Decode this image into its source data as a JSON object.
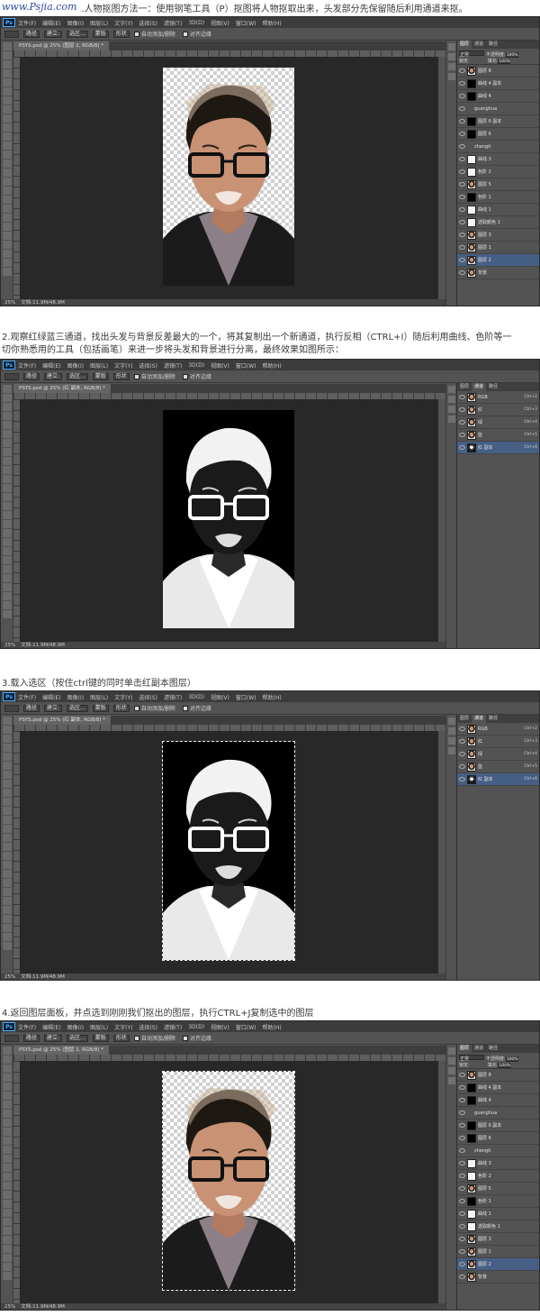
{
  "watermark": "www.Psjia.com",
  "steps": [
    {
      "caption": "1.人物抠图方法一：使用钢笔工具（P）抠图将人物抠取出来，头发部分先保留随后利用通道来抠。"
    },
    {
      "caption": "2.观察红绿蓝三通道，找出头发与背景反差最大的一个，将其复制出一个新通道，执行反相（CTRL+I）随后利用曲线、色阶等一",
      "caption2": "切你熟悉用的工具（包括画笔）来进一步将头发和背景进行分离，最终效果如图所示："
    },
    {
      "caption": "3.载入选区（按住ctrl键的同时单击红副本图层）"
    },
    {
      "caption": "4.返回图层面板，并点选到刚刚我们抠出的图层，执行CTRL+J复制选中的图层"
    }
  ],
  "ps": {
    "logo": "Ps",
    "menus": [
      "文件(F)",
      "编辑(E)",
      "图像(I)",
      "图层(L)",
      "文字(Y)",
      "选择(S)",
      "滤镜(T)",
      "3D(D)",
      "视图(V)",
      "窗口(W)",
      "帮助(H)"
    ],
    "options": [
      "路径",
      "建立:",
      "选区...",
      "蒙版",
      "形状"
    ],
    "auto_add": "自动添加/删除",
    "align_edges": "对齐边缘",
    "doc_tab": "PSYS.psd @ 25% (图层 2, RGB/8) *",
    "doc_tab_channel": "PSYS.psd @ 25% (红 副本, RGB/8) *",
    "zoom": "25%",
    "doc_size": "文档:11.9M/48.9M"
  },
  "layers_panel": {
    "tabs": [
      "图层",
      "通道",
      "路径"
    ],
    "mode": "正常",
    "opacity_label": "不透明度:",
    "opacity": "100%",
    "lock_label": "锁定:",
    "fill_label": "填充:",
    "fill": "100%",
    "layers": [
      {
        "name": "图层 8",
        "thumb": "face"
      },
      {
        "name": "曲线 4 副本",
        "thumb": "mask"
      },
      {
        "name": "曲线 4",
        "thumb": "mask"
      },
      {
        "name": "guanghua",
        "thumb": "group"
      },
      {
        "name": "图层 6 副本",
        "thumb": "mask"
      },
      {
        "name": "图层 6",
        "thumb": "mask"
      },
      {
        "name": "zhengti",
        "thumb": "group"
      },
      {
        "name": "曲线 3",
        "thumb": "white"
      },
      {
        "name": "色阶 2",
        "thumb": "white"
      },
      {
        "name": "图层 5",
        "thumb": "face"
      },
      {
        "name": "色阶 1",
        "thumb": "mask"
      },
      {
        "name": "曲线 1",
        "thumb": "white"
      },
      {
        "name": "选取颜色 1",
        "thumb": "white"
      },
      {
        "name": "图层 3",
        "thumb": "face"
      },
      {
        "name": "图层 1",
        "thumb": "face"
      },
      {
        "name": "图层 2",
        "thumb": "face",
        "selected": true
      },
      {
        "name": "背景",
        "thumb": "face"
      }
    ]
  },
  "channels_panel": {
    "tabs": [
      "图层",
      "通道",
      "路径"
    ],
    "channels": [
      {
        "name": "RGB",
        "shortcut": "Ctrl+2"
      },
      {
        "name": "红",
        "shortcut": "Ctrl+3"
      },
      {
        "name": "绿",
        "shortcut": "Ctrl+4"
      },
      {
        "name": "蓝",
        "shortcut": "Ctrl+5"
      },
      {
        "name": "红 副本",
        "shortcut": "Ctrl+6",
        "selected": true
      }
    ]
  }
}
